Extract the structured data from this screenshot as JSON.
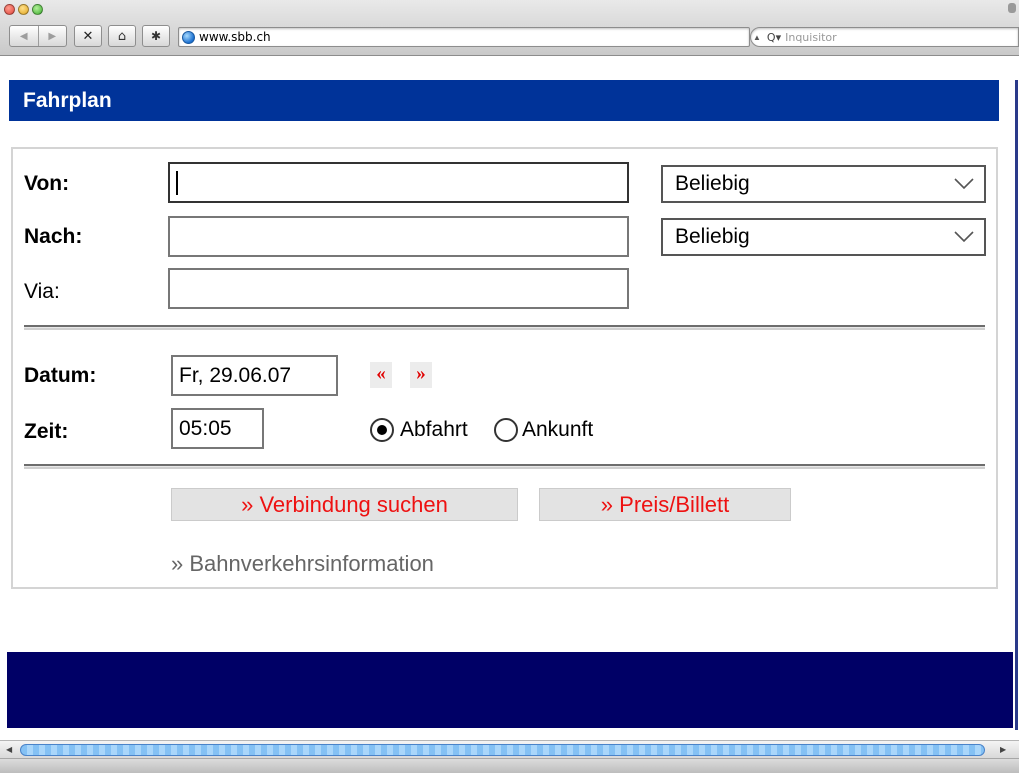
{
  "browser": {
    "url": "www.sbb.ch",
    "search_placeholder": "Inquisitor",
    "icons": {
      "back": "◀",
      "forward": "▶",
      "stop": "✕",
      "home": "⌂",
      "bug": "✱",
      "search": "Q▾",
      "address_menu": "▲"
    }
  },
  "page": {
    "title": "Fahrplan",
    "accent_color": "#003399",
    "footer_color": "#000066",
    "link_color": "#e11111"
  },
  "form": {
    "von_label": "Von:",
    "nach_label": "Nach:",
    "via_label": "Via:",
    "von_value": "",
    "nach_value": "",
    "via_value": "",
    "von_select": "Beliebig",
    "nach_select": "Beliebig",
    "datum_label": "Datum:",
    "datum_value": "Fr, 29.06.07",
    "prev_day": "«",
    "next_day": "»",
    "zeit_label": "Zeit:",
    "zeit_value": "05:05",
    "abfahrt_label": "Abfahrt",
    "ankunft_label": "Ankunft",
    "selected_mode": "Abfahrt",
    "search_button": "» Verbindung suchen",
    "price_button": "» Preis/Billett",
    "info_link": "» Bahnverkehrsinformation"
  }
}
